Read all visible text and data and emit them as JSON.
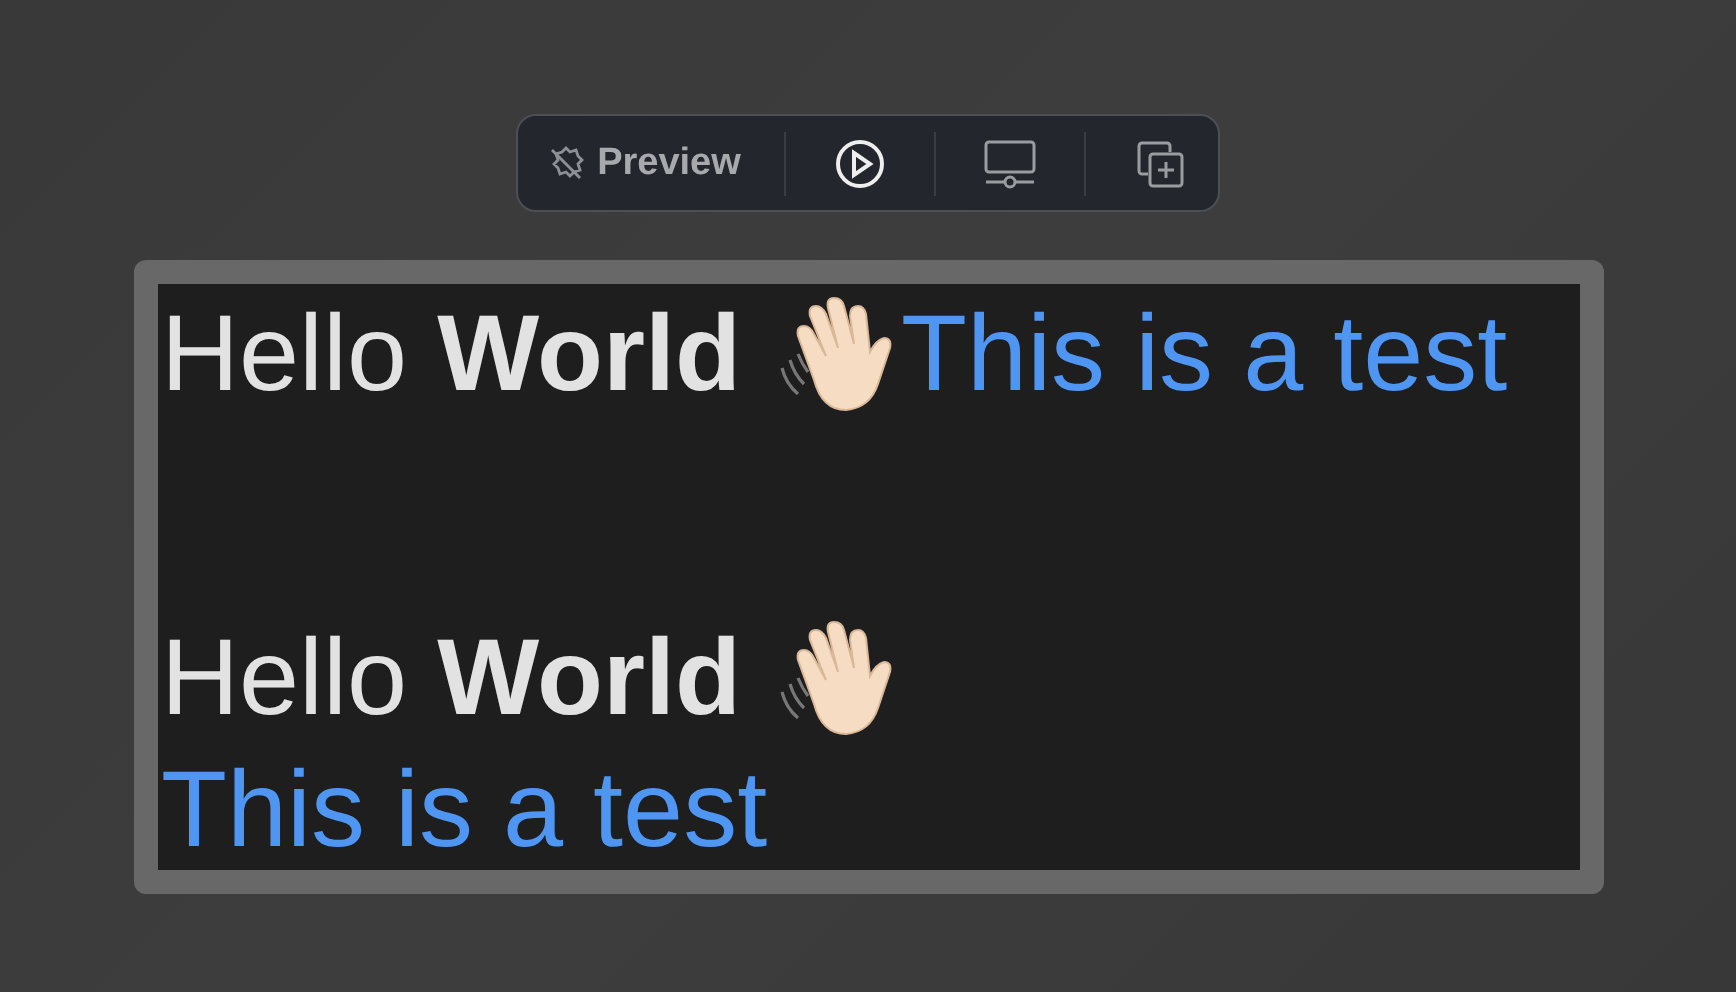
{
  "toolbar": {
    "label": "Preview"
  },
  "preview": [
    {
      "kind": "inline",
      "greeting": "Hello **World**",
      "note": "This is a test"
    },
    {
      "kind": "stacked",
      "greeting": "Hello **World**",
      "note": "This is a test"
    }
  ]
}
